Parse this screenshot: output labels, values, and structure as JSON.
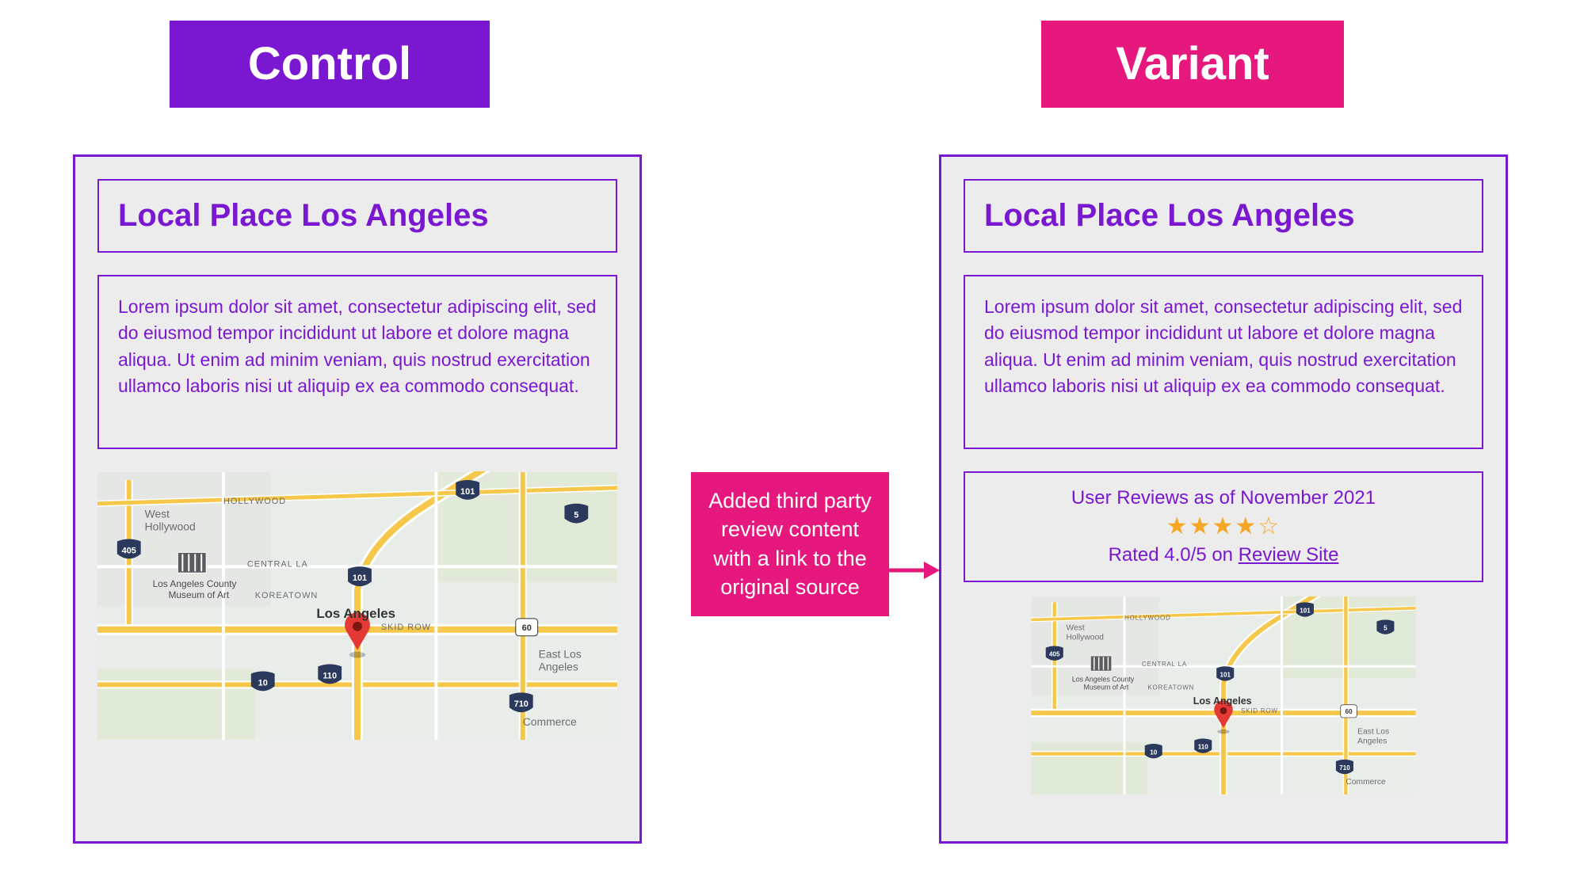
{
  "labels": {
    "control": "Control",
    "variant": "Variant"
  },
  "callout": "Added third party review content with a link to the original source",
  "control": {
    "title": "Local Place Los Angeles",
    "body": "Lorem ipsum dolor sit amet, consectetur adipiscing elit, sed do eiusmod tempor incididunt ut labore et dolore magna aliqua. Ut enim ad minim veniam, quis nostrud exercitation ullamco laboris nisi ut aliquip ex ea commodo consequat.",
    "map": {
      "city_label": "Los Angeles",
      "hoods": [
        "West Hollywood",
        "HOLLYWOOD",
        "CENTRAL LA",
        "KOREATOWN",
        "SKID ROW",
        "East Los Angeles",
        "Commerce"
      ],
      "museum_label_1": "Los Angeles County",
      "museum_label_2": "Museum of Art",
      "highways": [
        "10",
        "405",
        "101",
        "110",
        "710",
        "5",
        "60"
      ]
    }
  },
  "variant": {
    "title": "Local Place Los Angeles",
    "body": "Lorem ipsum dolor sit amet, consectetur adipiscing elit, sed do eiusmod tempor incididunt ut labore et dolore magna aliqua. Ut enim ad minim veniam, quis nostrud exercitation ullamco laboris nisi ut aliquip ex ea commodo consequat.",
    "review": {
      "header": "User Reviews as of November 2021",
      "stars_display": "★★★★☆",
      "rating_value": 4.0,
      "rating_scale": 5,
      "rated_prefix": "Rated 4.0/5 on ",
      "link_text": "Review Site"
    },
    "map": {
      "city_label": "Los Angeles",
      "hoods": [
        "West Hollywood",
        "HOLLYWOOD",
        "CENTRAL LA",
        "KOREATOWN",
        "SKID ROW",
        "East Los Angeles",
        "Commerce"
      ],
      "museum_label_1": "Los Angeles County",
      "museum_label_2": "Museum of Art",
      "highways": [
        "10",
        "405",
        "101",
        "110",
        "710",
        "5",
        "60"
      ]
    }
  },
  "colors": {
    "purple": "#7A17D1",
    "pink": "#E6187D",
    "panel_bg": "#ECECEC",
    "star": "#F6A623"
  }
}
